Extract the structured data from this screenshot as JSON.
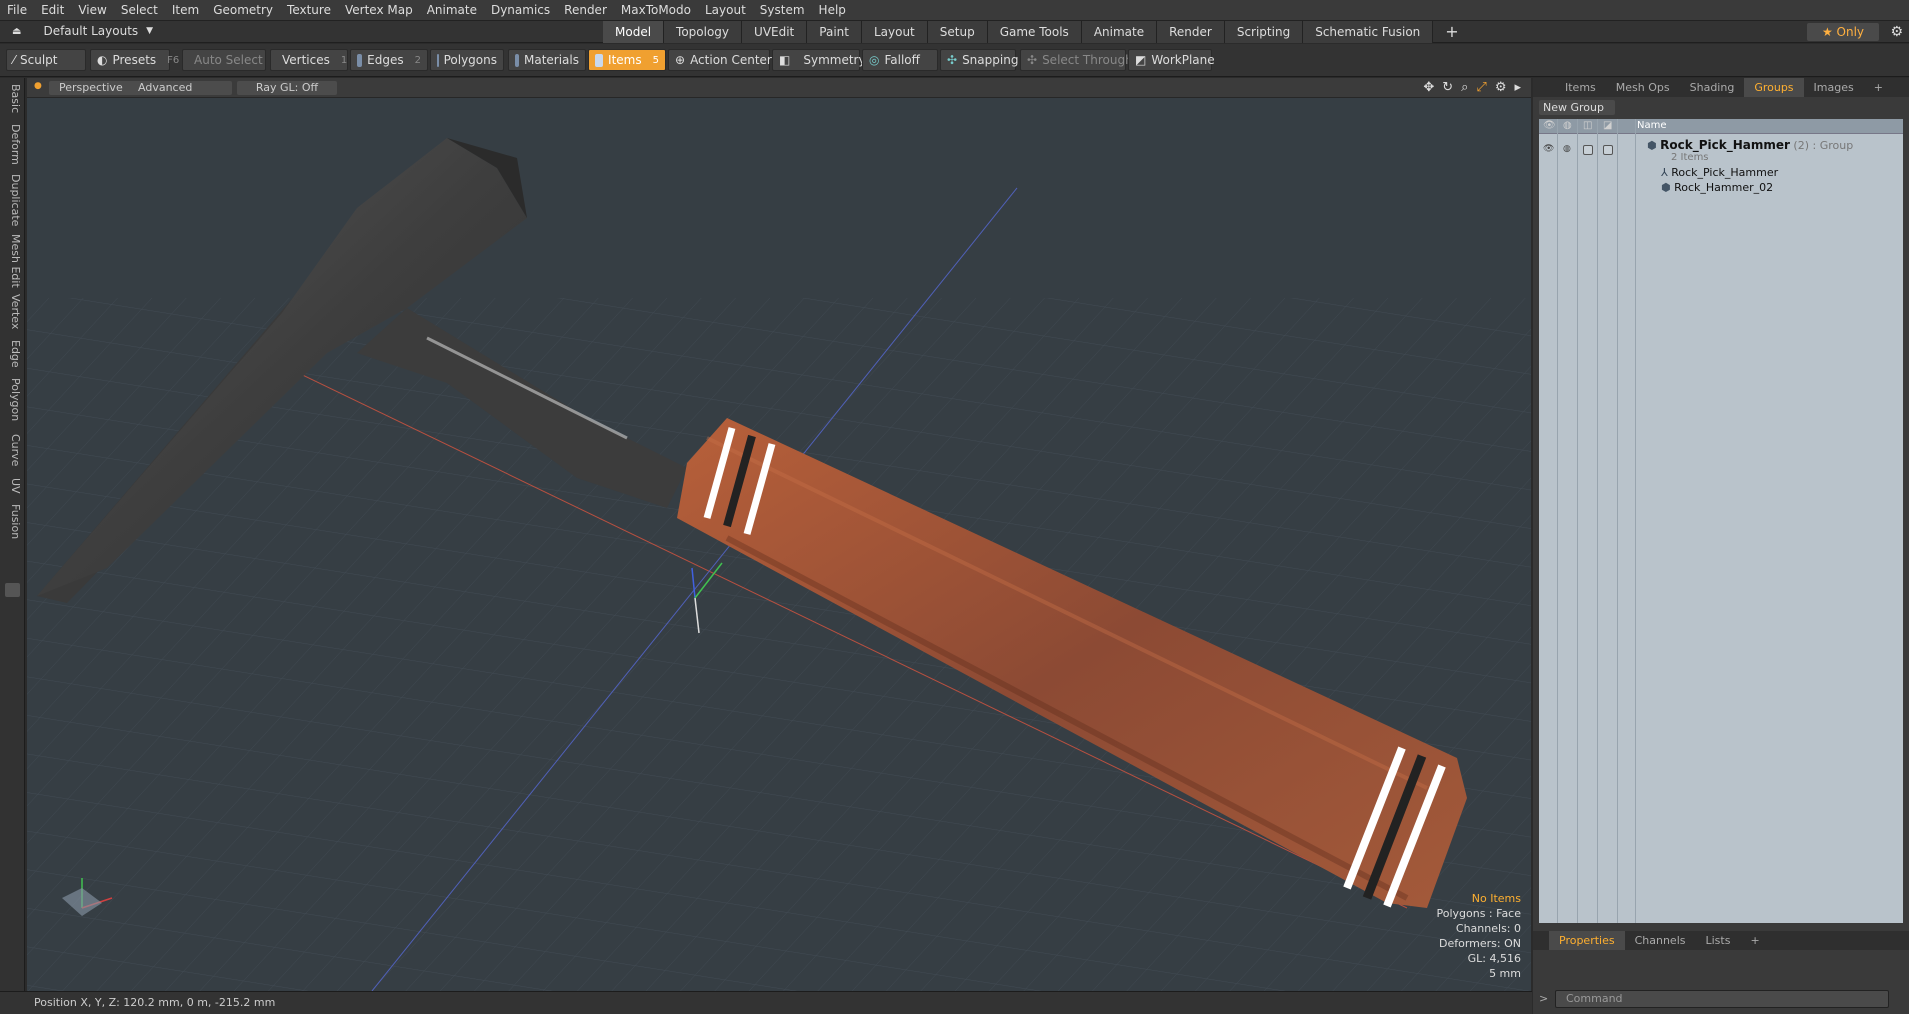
{
  "menu": [
    "File",
    "Edit",
    "View",
    "Select",
    "Item",
    "Geometry",
    "Texture",
    "Vertex Map",
    "Animate",
    "Dynamics",
    "Render",
    "MaxToModo",
    "Layout",
    "System",
    "Help"
  ],
  "layout_selector": "Default Layouts",
  "mode_tabs": [
    "Model",
    "Topology",
    "UVEdit",
    "Paint",
    "Layout",
    "Setup",
    "Game Tools",
    "Animate",
    "Render",
    "Scripting",
    "Schematic Fusion"
  ],
  "active_mode": "Model",
  "only_label": "Only",
  "toolbar": {
    "sculpt": "Sculpt",
    "presets": "Presets",
    "presets_key": "F6",
    "auto_select": "Auto Select",
    "vertices": "Vertices",
    "vertices_key": "1",
    "edges": "Edges",
    "edges_key": "2",
    "polygons": "Polygons",
    "materials": "Materials",
    "items": "Items",
    "items_key": "5",
    "action_center": "Action Center",
    "symmetry": "Symmetry",
    "falloff": "Falloff",
    "snapping": "Snapping",
    "select_through": "Select Through",
    "workplane": "WorkPlane"
  },
  "left_tabs": [
    "Basic",
    "Deform",
    "Duplicate",
    "Mesh Edit",
    "Vertex",
    "Edge",
    "Polygon",
    "Curve",
    "UV",
    "Fusion"
  ],
  "viewport": {
    "view": "Perspective",
    "shading": "Advanced",
    "raygl": "Ray GL: Off",
    "hud": {
      "items": "No Items",
      "polygons": "Polygons : Face",
      "channels": "Channels: 0",
      "deformers": "Deformers: ON",
      "gl": "GL: 4,516",
      "grid": "5 mm"
    }
  },
  "status": "Position X, Y, Z:   120.2 mm, 0 m, -215.2 mm",
  "right_panel": {
    "tabs": [
      "Items",
      "Mesh Ops",
      "Shading",
      "Groups",
      "Images"
    ],
    "active_tab": "Groups",
    "new_group": "New Group",
    "name_col": "Name",
    "group_name": "Rock_Pick_Hammer",
    "group_count": "(2)",
    "group_type": ": Group",
    "group_sub": "2 Items",
    "children": [
      "Rock_Pick_Hammer",
      "Rock_Hammer_02"
    ]
  },
  "bottom_panel": {
    "tabs": [
      "Properties",
      "Channels",
      "Lists"
    ],
    "active_tab": "Properties",
    "command_placeholder": "Command"
  },
  "colors": {
    "accent": "#f0a030",
    "viewport_bg": "#3a4248",
    "tree_bg": "#b9c3cb"
  }
}
